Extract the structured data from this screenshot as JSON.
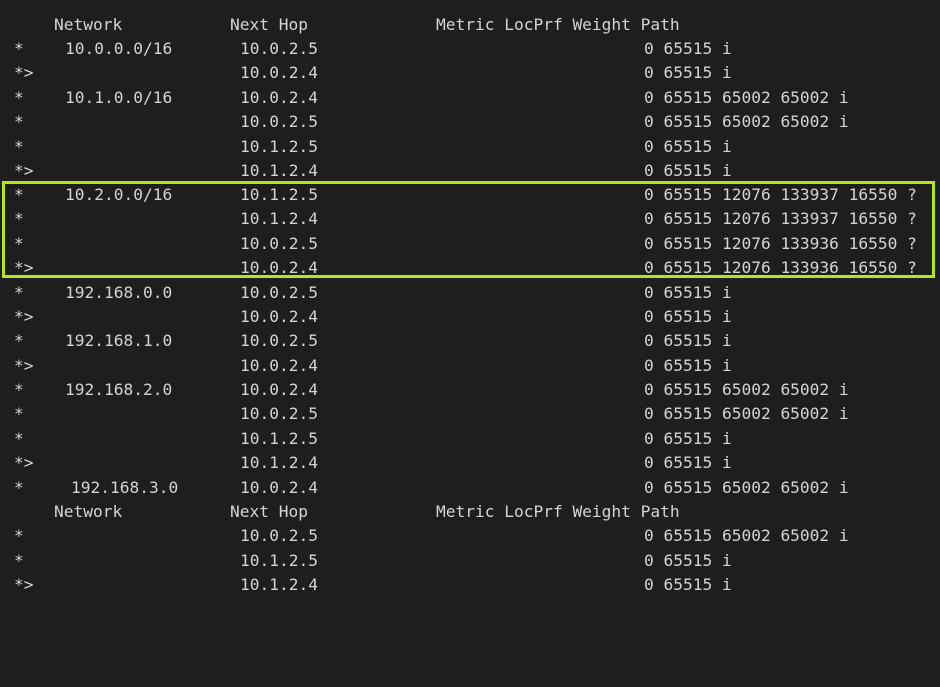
{
  "header": {
    "network": "Network",
    "next_hop": "Next Hop",
    "metrics": "Metric LocPrf Weight Path"
  },
  "rows": [
    {
      "status": "*",
      "network": "10.0.0.0/16",
      "next_hop": "10.0.2.5",
      "weight_path": "0 65515 i"
    },
    {
      "status": "*>",
      "network": "",
      "next_hop": "10.0.2.4",
      "weight_path": "0 65515 i"
    },
    {
      "status": "*",
      "network": "10.1.0.0/16",
      "next_hop": "10.0.2.4",
      "weight_path": "0 65515 65002 65002 i"
    },
    {
      "status": "*",
      "network": "",
      "next_hop": "10.0.2.5",
      "weight_path": "0 65515 65002 65002 i"
    },
    {
      "status": "*",
      "network": "",
      "next_hop": "10.1.2.5",
      "weight_path": "0 65515 i"
    },
    {
      "status": "*>",
      "network": "",
      "next_hop": "10.1.2.4",
      "weight_path": "0 65515 i"
    },
    {
      "status": "*",
      "network": "10.2.0.0/16",
      "next_hop": "10.1.2.5",
      "weight_path": "0 65515 12076 133937 16550 ?"
    },
    {
      "status": "*",
      "network": "",
      "next_hop": "10.1.2.4",
      "weight_path": "0 65515 12076 133937 16550 ?"
    },
    {
      "status": "*",
      "network": "",
      "next_hop": "10.0.2.5",
      "weight_path": "0 65515 12076 133936 16550 ?"
    },
    {
      "status": "*>",
      "network": "",
      "next_hop": "10.0.2.4",
      "weight_path": "0 65515 12076 133936 16550 ?"
    },
    {
      "status": "*",
      "network": "192.168.0.0",
      "next_hop": "10.0.2.5",
      "weight_path": "0 65515 i"
    },
    {
      "status": "*>",
      "network": "",
      "next_hop": "10.0.2.4",
      "weight_path": "0 65515 i"
    },
    {
      "status": "*",
      "network": "192.168.1.0",
      "next_hop": "10.0.2.5",
      "weight_path": "0 65515 i"
    },
    {
      "status": "*>",
      "network": "",
      "next_hop": "10.0.2.4",
      "weight_path": "0 65515 i"
    },
    {
      "status": "*",
      "network": "192.168.2.0",
      "next_hop": "10.0.2.4",
      "weight_path": "0 65515 65002 65002 i"
    },
    {
      "status": "*",
      "network": "",
      "next_hop": "10.0.2.5",
      "weight_path": "0 65515 65002 65002 i"
    },
    {
      "status": "*",
      "network": "",
      "next_hop": "10.1.2.5",
      "weight_path": "0 65515 i"
    },
    {
      "status": "*>",
      "network": "",
      "next_hop": "10.1.2.4",
      "weight_path": "0 65515 i"
    },
    {
      "status": "*",
      "network": "192.168.3.0",
      "next_hop": "10.0.2.4",
      "weight_path": "0 65515 65002 65002 i"
    }
  ],
  "header2": {
    "network": "Network",
    "next_hop": "Next Hop",
    "metrics": "Metric LocPrf Weight Path"
  },
  "rows2": [
    {
      "status": "*",
      "network": "",
      "next_hop": "10.0.2.5",
      "weight_path": "0 65515 65002 65002 i"
    },
    {
      "status": "*",
      "network": "",
      "next_hop": "10.1.2.5",
      "weight_path": "0 65515 i"
    },
    {
      "status": "*>",
      "network": "",
      "next_hop": "10.1.2.4",
      "weight_path": "0 65515 i"
    }
  ],
  "colors": {
    "background": "#1e1e1e",
    "text": "#d4d4d4",
    "highlight": "#b5e61d"
  }
}
